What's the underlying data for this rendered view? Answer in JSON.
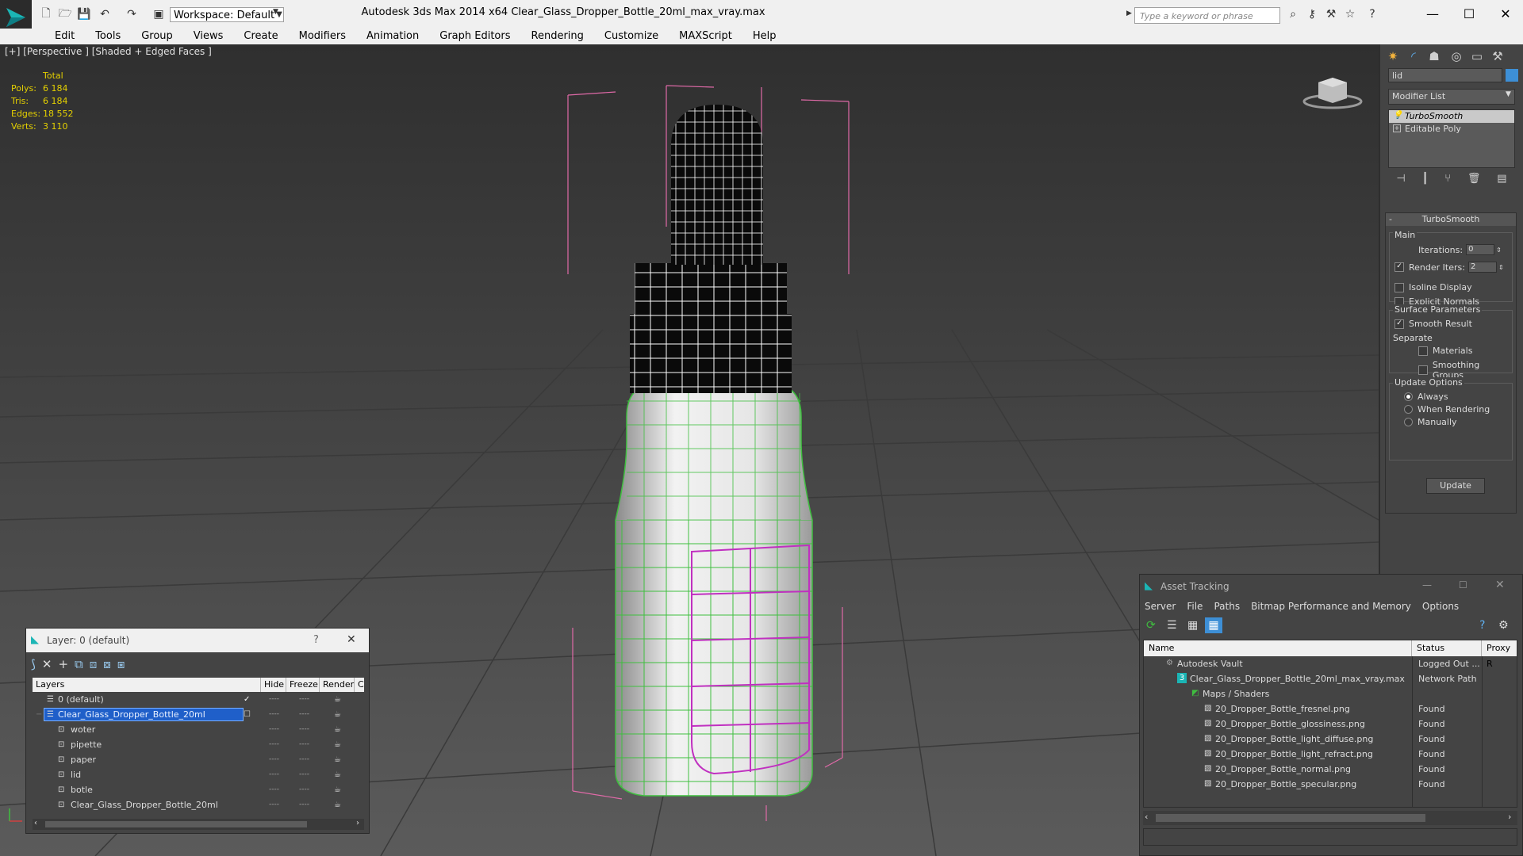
{
  "app": {
    "title": "Autodesk 3ds Max  2014 x64      Clear_Glass_Dropper_Bottle_20ml_max_vray.max",
    "workspace": "Workspace: Default",
    "search_placeholder": "Type a keyword or phrase"
  },
  "menu": [
    "Edit",
    "Tools",
    "Group",
    "Views",
    "Create",
    "Modifiers",
    "Animation",
    "Graph Editors",
    "Rendering",
    "Customize",
    "MAXScript",
    "Help"
  ],
  "viewport": {
    "label": "[+] [Perspective ] [Shaded + Edged Faces ]",
    "stats": {
      "header": "Total",
      "rows": [
        {
          "k": "Polys:",
          "v": "6 184"
        },
        {
          "k": "Tris:",
          "v": "6 184"
        },
        {
          "k": "Edges:",
          "v": "18 552"
        },
        {
          "k": "Verts:",
          "v": "3 110"
        }
      ]
    }
  },
  "command_panel": {
    "object_name": "lid",
    "modifier_list": "Modifier List",
    "stack": [
      {
        "label": "TurboSmooth",
        "selected": true
      },
      {
        "label": "Editable Poly",
        "selected": false
      }
    ],
    "rollout_title": "TurboSmooth",
    "main_group": "Main",
    "iterations_label": "Iterations:",
    "iterations_value": "0",
    "render_iters_label": "Render Iters:",
    "render_iters_value": "2",
    "isoline_label": "Isoline Display",
    "explicit_normals_label": "Explicit Normals",
    "surface_group": "Surface Parameters",
    "smooth_result_label": "Smooth Result",
    "separate_label": "Separate",
    "materials_label": "Materials",
    "smoothing_groups_label": "Smoothing Groups",
    "update_group": "Update Options",
    "always_label": "Always",
    "when_rendering_label": "When Rendering",
    "manually_label": "Manually",
    "update_button": "Update"
  },
  "layer_dialog": {
    "title": "Layer: 0 (default)",
    "help": "?",
    "close": "✕",
    "columns": [
      "Layers",
      "Hide",
      "Freeze",
      "Render",
      "C"
    ],
    "rows": [
      {
        "name": "0 (default)",
        "level": 0,
        "selected": false
      },
      {
        "name": "Clear_Glass_Dropper_Bottle_20ml",
        "level": 0,
        "selected": true
      },
      {
        "name": "woter",
        "level": 1,
        "selected": false
      },
      {
        "name": "pipette",
        "level": 1,
        "selected": false
      },
      {
        "name": "paper",
        "level": 1,
        "selected": false
      },
      {
        "name": "lid",
        "level": 1,
        "selected": false
      },
      {
        "name": "botle",
        "level": 1,
        "selected": false
      },
      {
        "name": "Clear_Glass_Dropper_Bottle_20ml",
        "level": 1,
        "selected": false
      }
    ]
  },
  "asset_tracking": {
    "title": "Asset Tracking",
    "menu": [
      "Server",
      "File",
      "Paths",
      "Bitmap Performance and Memory",
      "Options"
    ],
    "columns": [
      "Name",
      "Status",
      "Proxy R"
    ],
    "rows": [
      {
        "name": "Autodesk Vault",
        "status": "Logged Out ...",
        "level": 1
      },
      {
        "name": "Clear_Glass_Dropper_Bottle_20ml_max_vray.max",
        "status": "Network Path",
        "level": 2
      },
      {
        "name": "Maps / Shaders",
        "status": "",
        "level": 3
      },
      {
        "name": "20_Dropper_Bottle_fresnel.png",
        "status": "Found",
        "level": 4
      },
      {
        "name": "20_Dropper_Bottle_glossiness.png",
        "status": "Found",
        "level": 4
      },
      {
        "name": "20_Dropper_Bottle_light_diffuse.png",
        "status": "Found",
        "level": 4
      },
      {
        "name": "20_Dropper_Bottle_light_refract.png",
        "status": "Found",
        "level": 4
      },
      {
        "name": "20_Dropper_Bottle_normal.png",
        "status": "Found",
        "level": 4
      },
      {
        "name": "20_Dropper_Bottle_specular.png",
        "status": "Found",
        "level": 4
      }
    ]
  },
  "colors": {
    "accent": "#3d8fd6",
    "stats_yellow": "#e4d000",
    "selection_blue": "#1f5fc9",
    "wire_green": "#3fbf3f",
    "bbox_pink": "#e06aa8"
  }
}
